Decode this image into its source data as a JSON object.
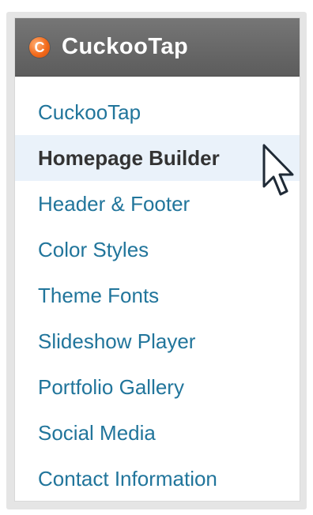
{
  "menu": {
    "title": "CuckooTap",
    "logo_letter": "C",
    "items": [
      {
        "label": "CuckooTap"
      },
      {
        "label": "Homepage Builder"
      },
      {
        "label": "Header & Footer"
      },
      {
        "label": "Color Styles"
      },
      {
        "label": "Theme Fonts"
      },
      {
        "label": "Slideshow Player"
      },
      {
        "label": "Portfolio Gallery"
      },
      {
        "label": "Social Media"
      },
      {
        "label": "Contact Information"
      }
    ],
    "active_index": 1
  },
  "colors": {
    "link": "#21759b",
    "active_text": "#333333",
    "active_bg": "#eaf2fa",
    "header_bg": "#666666",
    "logo": "#f26a1b"
  },
  "icons": {
    "logo": "cuckootap-logo-icon",
    "cursor": "mouse-pointer-icon"
  }
}
